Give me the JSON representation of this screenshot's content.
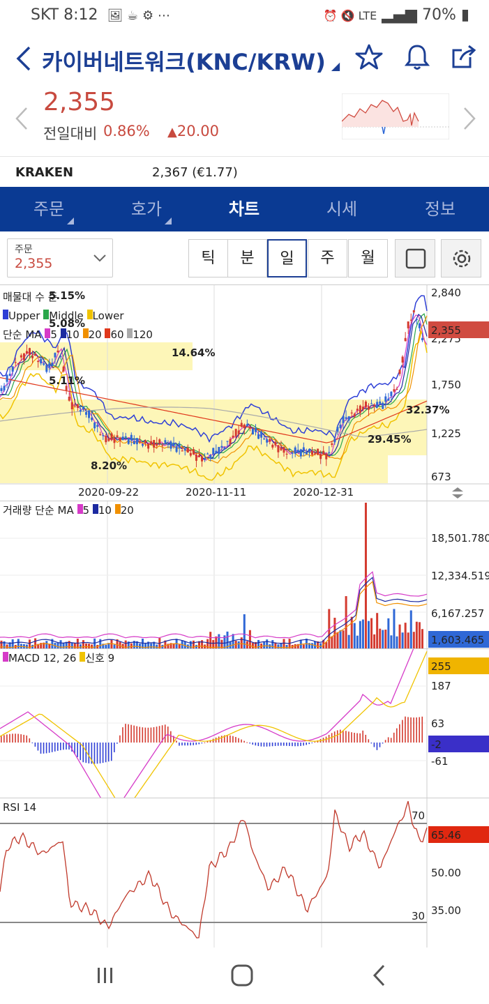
{
  "status": {
    "carrier": "SKT",
    "time": "8:12",
    "left_icons": "🖼 ☕ ⚙ ⋯",
    "right_icons": "⏰ 🔇 LTE",
    "battery": "70%"
  },
  "header": {
    "title": "카이버네트워크(KNC/KRW)"
  },
  "price": {
    "value": "2,355",
    "change_label": "전일대비",
    "change_pct": "0.86%",
    "change_amt": "20.00"
  },
  "kraken": {
    "name": "KRAKEN",
    "value": "2,367 (€1.77)"
  },
  "tabs": [
    {
      "label": "주문"
    },
    {
      "label": "호가"
    },
    {
      "label": "차트"
    },
    {
      "label": "시세"
    },
    {
      "label": "정보"
    }
  ],
  "toolbar": {
    "order_label": "주문",
    "order_value": "2,355",
    "periods": [
      "틱",
      "분",
      "일",
      "주",
      "월"
    ]
  },
  "chart_data": [
    {
      "type": "candlestick",
      "panel": "price",
      "legend": {
        "title": "매물대 수 준",
        "bands": [
          "Upper",
          "Middle",
          "Lower"
        ],
        "ma_title": "단순 MA",
        "ma": [
          "5",
          "10",
          "20",
          "60",
          "120"
        ]
      },
      "x_ticks": [
        "2020-09-22",
        "2020-11-11",
        "2020-12-31"
      ],
      "y_ticks": [
        "2,840",
        "2,275",
        "1,750",
        "1,225",
        "673"
      ],
      "current": "2,355",
      "percent_labels": [
        "5.15%",
        "5.08%",
        "5.11%",
        "14.64%",
        "8.20%",
        "32.37%",
        "29.45%"
      ],
      "colors": {
        "upper": "#2e3fd6",
        "middle": "#2aa64a",
        "lower": "#f0c300",
        "ma5": "#d63bc8",
        "ma10": "#1c2aa0",
        "ma20": "#f09000",
        "ma60": "#e0381c",
        "ma120": "#aaaaaa",
        "up": "#d43a2f",
        "down": "#2f68d6"
      }
    },
    {
      "type": "bar",
      "panel": "volume",
      "title": "거래량 단순 MA",
      "ma": [
        "5",
        "10",
        "20"
      ],
      "y_ticks": [
        "18,501.780",
        "12,334.519",
        "6,167.257"
      ],
      "current": "1,603.465"
    },
    {
      "type": "line",
      "panel": "macd",
      "title": "MACD 12, 26",
      "signal": "신호 9",
      "y_ticks": [
        "187",
        "63",
        "-61"
      ],
      "current_macd": "255",
      "current_hist": "-2"
    },
    {
      "type": "line",
      "panel": "rsi",
      "title": "RSI 14",
      "y_ticks": [
        "50.00",
        "35.00"
      ],
      "levels": [
        "70",
        "30"
      ],
      "current": "65.46"
    }
  ]
}
